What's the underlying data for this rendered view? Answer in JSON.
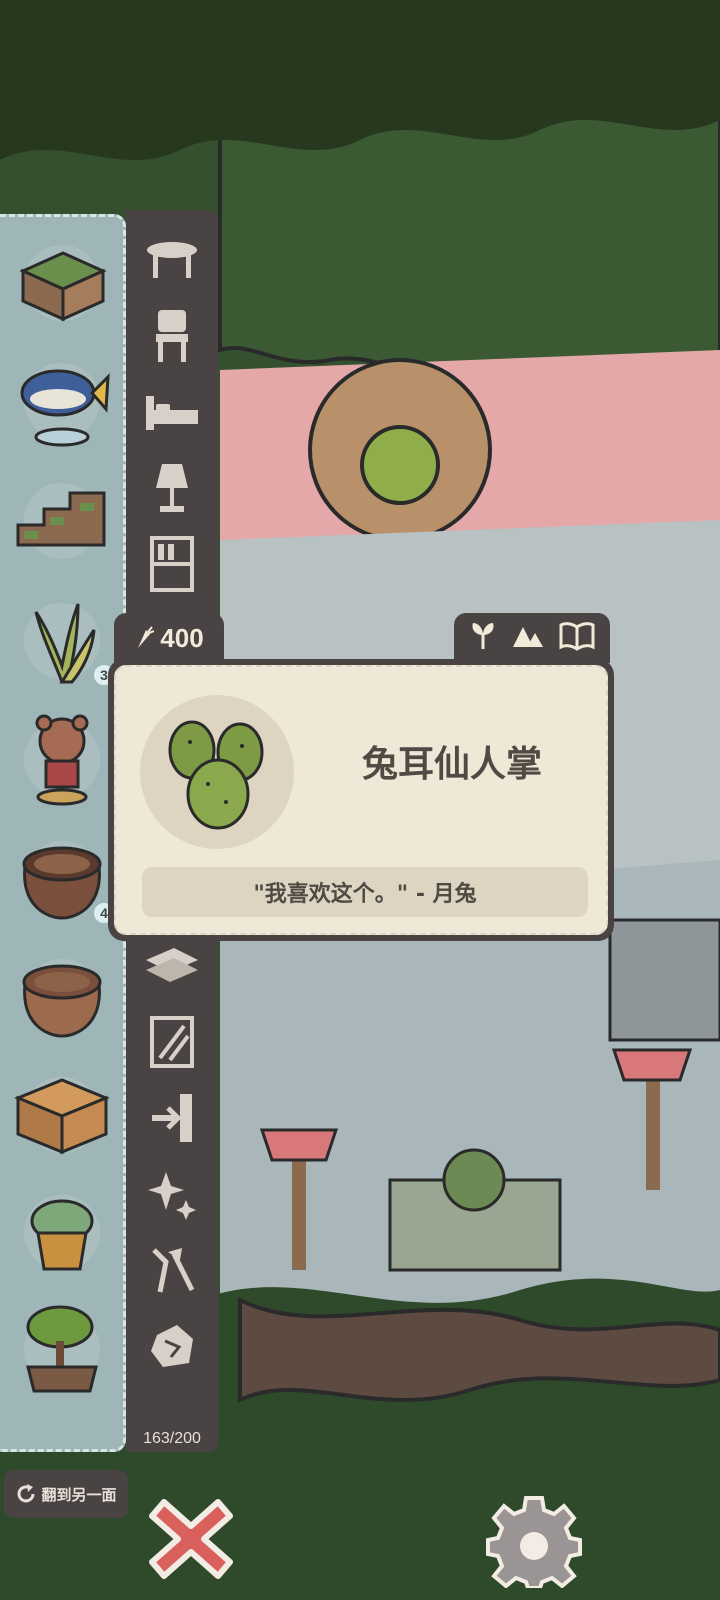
{
  "price": {
    "icon": "carrot-icon",
    "value": "400"
  },
  "item": {
    "name": "兔耳仙人掌",
    "quote": "\"我喜欢这个。\" - 月兔"
  },
  "card_actions": [
    {
      "name": "plant-icon"
    },
    {
      "name": "mountain-icon"
    },
    {
      "name": "book-icon"
    }
  ],
  "inventory": {
    "items": [
      {
        "name": "green-chest",
        "count": ""
      },
      {
        "name": "tuna-statue",
        "count": ""
      },
      {
        "name": "stair-cabinet",
        "count": ""
      },
      {
        "name": "snake-plant",
        "count": "3"
      },
      {
        "name": "bear-figurine",
        "count": ""
      },
      {
        "name": "clay-pot-dark",
        "count": "4"
      },
      {
        "name": "clay-pot",
        "count": ""
      },
      {
        "name": "wooden-nightstand",
        "count": ""
      },
      {
        "name": "succulent-pot",
        "count": ""
      },
      {
        "name": "bonsai-tree",
        "count": ""
      }
    ],
    "capacity": "163/200",
    "flip_label": "翻到另一面"
  },
  "categories": [
    "table-icon",
    "chair-icon",
    "bed-icon",
    "lamp-icon",
    "shelf-icon",
    "floor-icon",
    "wallpaper-icon",
    "door-icon",
    "sparkle-icon",
    "tools-icon",
    "rock-icon"
  ],
  "colors": {
    "panel_dark": "#4a4343",
    "inventory_bg": "#9fb6b8",
    "card_bg": "#efe8d6",
    "close_red": "#d9605c"
  }
}
